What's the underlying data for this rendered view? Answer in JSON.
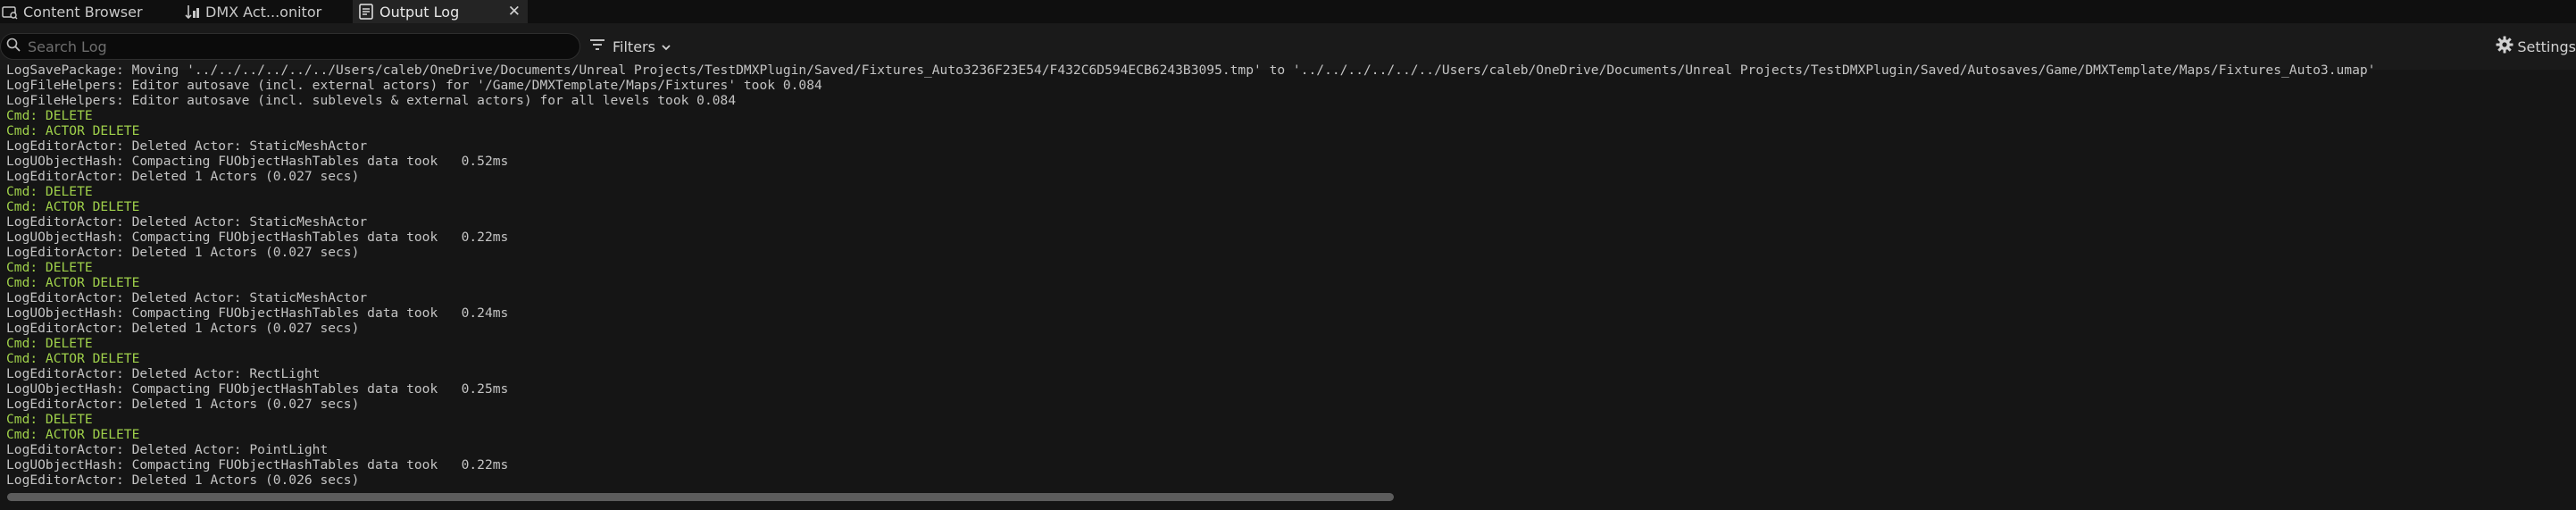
{
  "tabs": [
    {
      "label": "Content Browser",
      "icon": "content-browser-icon"
    },
    {
      "label": "DMX Act...onitor",
      "icon": "dmx-monitor-icon"
    },
    {
      "label": "Output Log",
      "icon": "output-log-icon",
      "active": true,
      "close": "✕"
    }
  ],
  "toolbar": {
    "search_placeholder": "Search Log",
    "filters_label": "Filters",
    "settings_label": "Settings"
  },
  "log_lines": [
    {
      "text": "LogSavePackage: Moving '../../../../../../Users/caleb/OneDrive/Documents/Unreal Projects/TestDMXPlugin/Saved/Fixtures_Auto3236F23E54/F432C6D594ECB6243B3095.tmp' to '../../../../../../Users/caleb/OneDrive/Documents/Unreal Projects/TestDMXPlugin/Saved/Autosaves/Game/DMXTemplate/Maps/Fixtures_Auto3.umap'",
      "type": "info"
    },
    {
      "text": "LogFileHelpers: Editor autosave (incl. external actors) for '/Game/DMXTemplate/Maps/Fixtures' took 0.084",
      "type": "info"
    },
    {
      "text": "LogFileHelpers: Editor autosave (incl. sublevels & external actors) for all levels took 0.084",
      "type": "info"
    },
    {
      "text": "Cmd: DELETE",
      "type": "cmd"
    },
    {
      "text": "Cmd: ACTOR DELETE",
      "type": "cmd"
    },
    {
      "text": "LogEditorActor: Deleted Actor: StaticMeshActor",
      "type": "info"
    },
    {
      "text": "LogUObjectHash: Compacting FUObjectHashTables data took   0.52ms",
      "type": "info"
    },
    {
      "text": "LogEditorActor: Deleted 1 Actors (0.027 secs)",
      "type": "info"
    },
    {
      "text": "Cmd: DELETE",
      "type": "cmd"
    },
    {
      "text": "Cmd: ACTOR DELETE",
      "type": "cmd"
    },
    {
      "text": "LogEditorActor: Deleted Actor: StaticMeshActor",
      "type": "info"
    },
    {
      "text": "LogUObjectHash: Compacting FUObjectHashTables data took   0.22ms",
      "type": "info"
    },
    {
      "text": "LogEditorActor: Deleted 1 Actors (0.027 secs)",
      "type": "info"
    },
    {
      "text": "Cmd: DELETE",
      "type": "cmd"
    },
    {
      "text": "Cmd: ACTOR DELETE",
      "type": "cmd"
    },
    {
      "text": "LogEditorActor: Deleted Actor: StaticMeshActor",
      "type": "info"
    },
    {
      "text": "LogUObjectHash: Compacting FUObjectHashTables data took   0.24ms",
      "type": "info"
    },
    {
      "text": "LogEditorActor: Deleted 1 Actors (0.027 secs)",
      "type": "info"
    },
    {
      "text": "Cmd: DELETE",
      "type": "cmd"
    },
    {
      "text": "Cmd: ACTOR DELETE",
      "type": "cmd"
    },
    {
      "text": "LogEditorActor: Deleted Actor: RectLight",
      "type": "info"
    },
    {
      "text": "LogUObjectHash: Compacting FUObjectHashTables data took   0.25ms",
      "type": "info"
    },
    {
      "text": "LogEditorActor: Deleted 1 Actors (0.027 secs)",
      "type": "info"
    },
    {
      "text": "Cmd: DELETE",
      "type": "cmd"
    },
    {
      "text": "Cmd: ACTOR DELETE",
      "type": "cmd"
    },
    {
      "text": "LogEditorActor: Deleted Actor: PointLight",
      "type": "info"
    },
    {
      "text": "LogUObjectHash: Compacting FUObjectHashTables data took   0.22ms",
      "type": "info"
    },
    {
      "text": "LogEditorActor: Deleted 1 Actors (0.026 secs)",
      "type": "info"
    }
  ],
  "colors": {
    "cmd": "#9fd04a",
    "info": "#c4c4c4",
    "background": "#151515"
  }
}
